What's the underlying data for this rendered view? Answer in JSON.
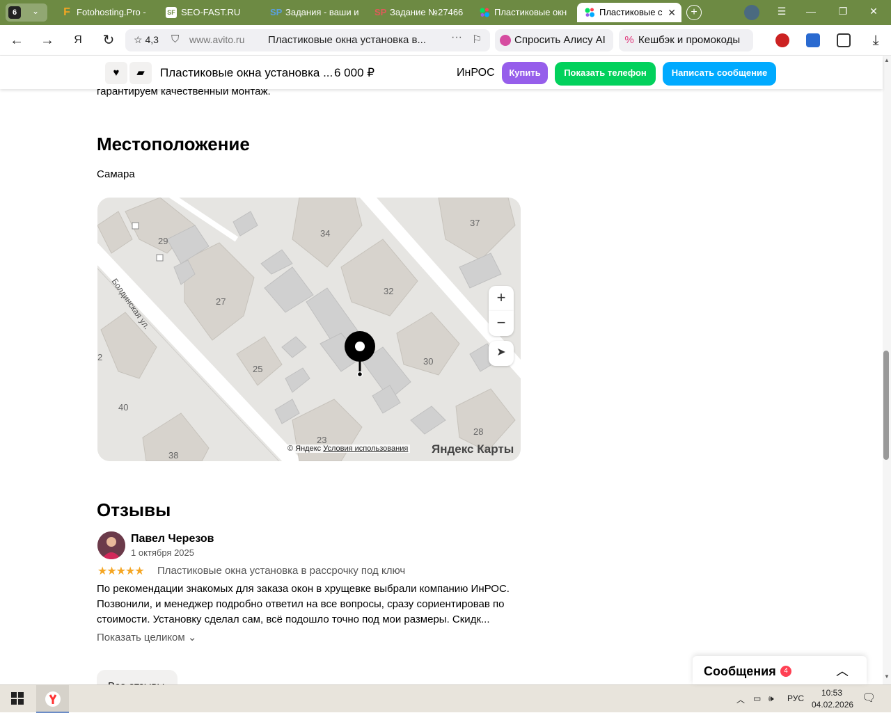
{
  "browser": {
    "tab_count": "6",
    "tabs": [
      {
        "label": "Fotohosting.Pro -",
        "icon": "F"
      },
      {
        "label": "SEO-FAST.RU",
        "icon": "SF"
      },
      {
        "label": "Задания - ваши и",
        "icon": "SP"
      },
      {
        "label": "Задание №27466",
        "icon": "SP"
      },
      {
        "label": "Пластиковые окн",
        "icon": "avito-icon"
      },
      {
        "label": "Пластиковые с",
        "icon": "avito-icon"
      }
    ],
    "rating": "4,3",
    "host": "www.avito.ru",
    "page_title": "Пластиковые окна установка в...",
    "alice_label": "Спросить Алису AI",
    "cashback_label": "Кешбэк и промокоды"
  },
  "sticky": {
    "title": "Пластиковые окна установка ...",
    "price": "6 000 ₽",
    "seller": "ИнРОС",
    "buy": "Купить",
    "show_phone": "Показать телефон",
    "write_message": "Написать сообщение"
  },
  "content": {
    "prev_text": "гарантируем качественный монтаж.",
    "location_heading": "Местоположение",
    "city": "Самара",
    "map": {
      "street": "Болдинская ул.",
      "labels": [
        "29",
        "34",
        "37",
        "27",
        "32",
        "2",
        "25",
        "30",
        "40",
        "28",
        "23",
        "38"
      ],
      "copyright": "© Яндекс",
      "terms": "Условия использования",
      "logo": "Яндекс Карты",
      "zoom_in": "+",
      "zoom_out": "−"
    },
    "reviews_heading": "Отзывы",
    "review": {
      "author": "Павел Черезов",
      "date": "1 октября 2025",
      "rating": 5,
      "stars": "★★★★★",
      "subject": "Пластиковые окна установка в рассрочку под ключ",
      "text": "По рекомендации знакомых для заказа окон в хрущевке выбрали компанию ИнРОС. Позвонили, и менеджер подробно ответил на все вопросы, сразу сориентировав по стоимости. Установку сделал сам, всё подошло точно под мои размеры. Скидк...",
      "show_all": "Показать целиком ⌄"
    },
    "all_reviews": "Все отзывы"
  },
  "messages": {
    "label": "Сообщения",
    "count": "4"
  },
  "taskbar": {
    "lang": "РУС",
    "time": "10:53",
    "date": "04.02.2026"
  }
}
